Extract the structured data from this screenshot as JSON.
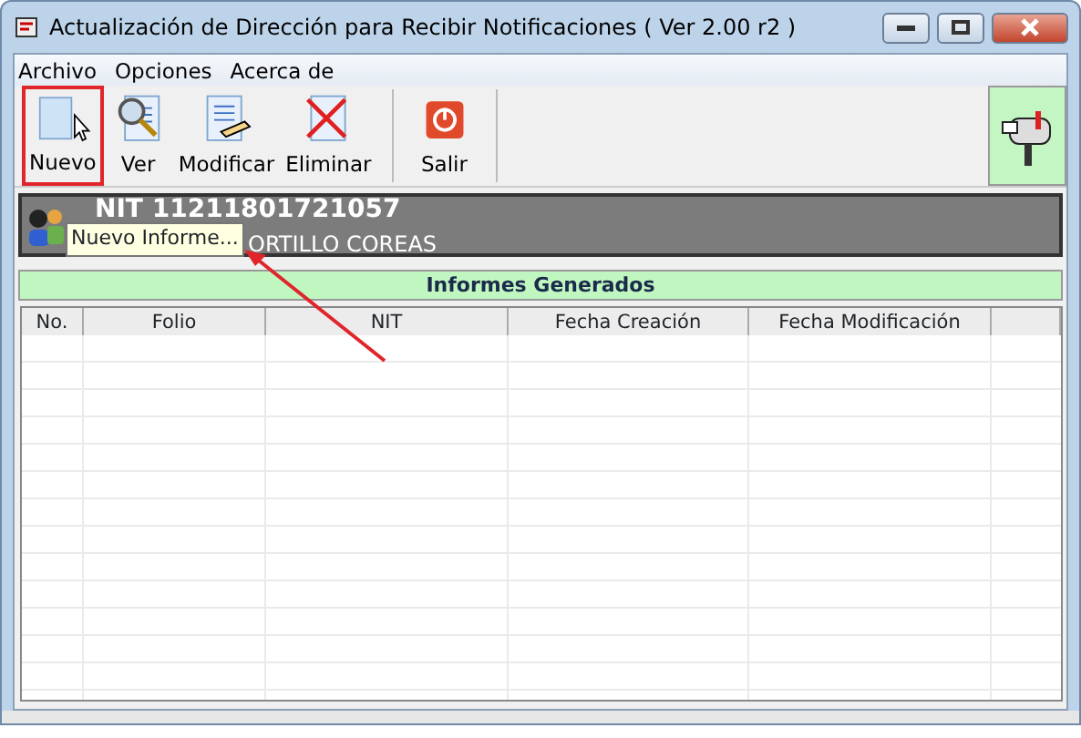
{
  "window": {
    "title": "Actualización de Dirección para Recibir Notificaciones ( Ver 2.00 r2 )"
  },
  "menu": [
    "Archivo",
    "Opciones",
    "Acerca de"
  ],
  "toolbar": [
    {
      "label": "Nuevo",
      "kind": "new",
      "highlighted": true
    },
    {
      "label": "Ver",
      "kind": "view",
      "highlighted": false
    },
    {
      "label": "Modificar",
      "kind": "edit",
      "highlighted": false
    },
    {
      "label": "Eliminar",
      "kind": "delete",
      "highlighted": false
    },
    {
      "label": "Salir",
      "kind": "exit",
      "highlighted": false
    }
  ],
  "taxpayer": {
    "nit": "NIT 11211801721057",
    "name": "ORTILLO COREAS"
  },
  "tooltip": "Nuevo Informe...",
  "reports": {
    "title": "Informes Generados",
    "columns": [
      "No.",
      "Folio",
      "NIT",
      "Fecha Creación",
      "Fecha Modificación"
    ]
  }
}
